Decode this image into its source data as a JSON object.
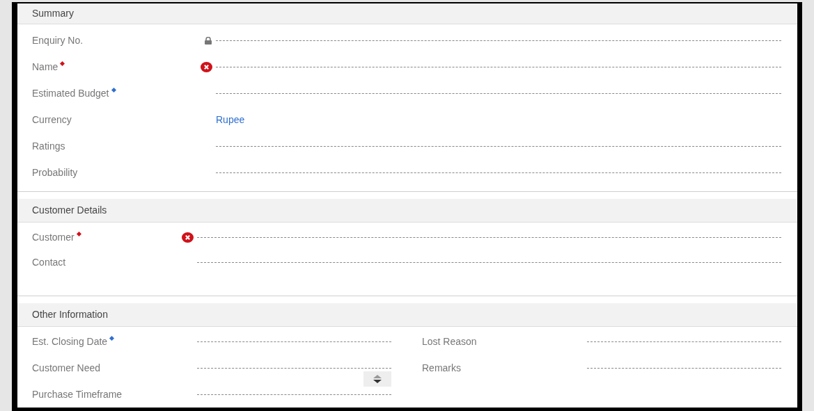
{
  "sections": [
    {
      "title": "Summary",
      "kind": "single",
      "columns": [
        [
          {
            "label": "Enquiry No.",
            "locked": true,
            "error": false,
            "required": false,
            "recommended": false
          },
          {
            "label": "Name",
            "locked": false,
            "error": true,
            "required": true,
            "recommended": false
          },
          {
            "label": "Estimated Budget",
            "locked": false,
            "error": false,
            "required": false,
            "recommended": true
          },
          {
            "label": "Currency",
            "value": "Rupee",
            "locked": false,
            "error": false,
            "required": false,
            "recommended": false
          },
          {
            "label": "Ratings",
            "locked": false,
            "error": false,
            "required": false,
            "recommended": false
          },
          {
            "label": "Probability",
            "locked": false,
            "error": false,
            "required": false,
            "recommended": false
          }
        ]
      ]
    },
    {
      "title": "Customer Details",
      "kind": "single",
      "columns": [
        [
          {
            "label": "Customer",
            "locked": false,
            "error": true,
            "required": true,
            "recommended": false
          },
          {
            "label": "Contact",
            "locked": false,
            "error": false,
            "required": false,
            "recommended": false
          }
        ]
      ]
    },
    {
      "title": "Other Information",
      "kind": "double",
      "columns": [
        [
          {
            "label": "Est. Closing Date",
            "locked": false,
            "error": false,
            "required": false,
            "recommended": true
          },
          {
            "label": "Customer Need",
            "stepper": true,
            "locked": false,
            "error": false,
            "required": false,
            "recommended": false
          },
          {
            "label": "Purchase Timeframe",
            "locked": false,
            "error": false,
            "required": false,
            "recommended": false
          }
        ],
        [
          {
            "label": "Lost Reason",
            "locked": false,
            "error": false,
            "required": false,
            "recommended": false
          },
          {
            "label": "Remarks",
            "locked": false,
            "error": false,
            "required": false,
            "recommended": false
          }
        ]
      ]
    }
  ]
}
